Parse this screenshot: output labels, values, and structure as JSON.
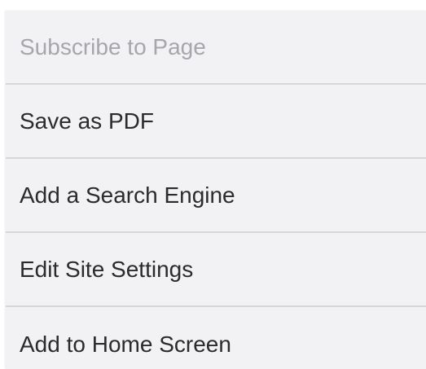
{
  "menu": {
    "items": [
      {
        "label": "Subscribe to Page",
        "enabled": false
      },
      {
        "label": "Save as PDF",
        "enabled": true
      },
      {
        "label": "Add a Search Engine",
        "enabled": true
      },
      {
        "label": "Edit Site Settings",
        "enabled": true
      },
      {
        "label": "Add to Home Screen",
        "enabled": true
      }
    ]
  },
  "colors": {
    "background": "#f2f2f4",
    "text": "#2b2b2e",
    "disabled_text": "#a7a7ab",
    "divider": "#d6d6d9"
  }
}
